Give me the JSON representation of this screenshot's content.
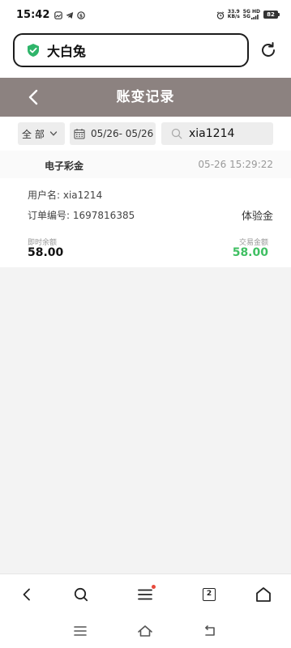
{
  "status_bar": {
    "time": "15:42",
    "left_icons": [
      "gallery-icon",
      "telegram-icon",
      "shield-icon"
    ],
    "net_speed_value": "33.9",
    "net_speed_unit": "KB/s",
    "net_type_1": "5G HD",
    "net_type_2": "5G",
    "battery": "82"
  },
  "browser": {
    "url_text": "大白兔",
    "secure_color": "#2fb56a"
  },
  "header": {
    "title": "账变记录",
    "background": "#8c8280"
  },
  "filters": {
    "type_selected": "全 部",
    "date_range": "05/26- 05/26",
    "search_value": "xia1214"
  },
  "records": [
    {
      "type": "电子彩金",
      "time": "05-26 15:29:22",
      "username_label": "用户名:",
      "username": "xia1214",
      "order_label": "订单编号:",
      "order_no": "1697816385",
      "tag": "体验金",
      "balance_label": "即时余额",
      "balance": "58.00",
      "amount_label": "交易金额",
      "amount": "58.00",
      "amount_color": "#3fbf62"
    }
  ],
  "bottom_bar": {
    "tab_count": "2"
  }
}
